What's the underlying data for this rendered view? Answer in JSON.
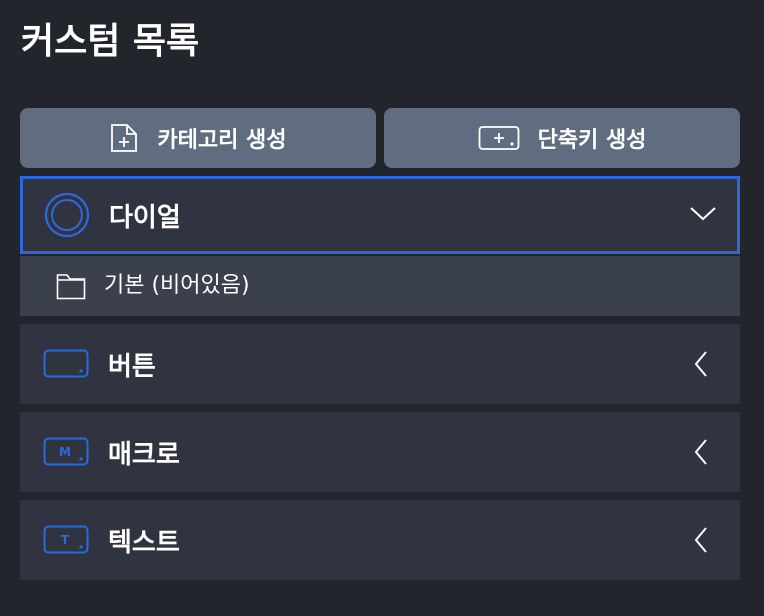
{
  "header": {
    "title": "커스텀 목록"
  },
  "actions": {
    "create_category_label": "카테고리 생성",
    "create_shortcut_label": "단축키 생성",
    "create_category_icon": "folder-plus-icon",
    "create_shortcut_icon": "keyboard-plus-icon"
  },
  "categories": [
    {
      "label": "다이얼",
      "icon": "dial-icon",
      "expanded": true,
      "children": [
        {
          "label": "기본 (비어있음)",
          "icon": "folder-icon"
        }
      ]
    },
    {
      "label": "버튼",
      "icon": "button-icon",
      "expanded": false
    },
    {
      "label": "매크로",
      "icon": "macro-icon",
      "icon_letter": "M",
      "expanded": false
    },
    {
      "label": "텍스트",
      "icon": "text-icon",
      "icon_letter": "T",
      "expanded": false
    }
  ],
  "colors": {
    "background": "#23252d",
    "action_button": "#606c80",
    "category_row": "#2f3440",
    "sub_row": "#3a404c",
    "accent": "#2e68e0"
  }
}
